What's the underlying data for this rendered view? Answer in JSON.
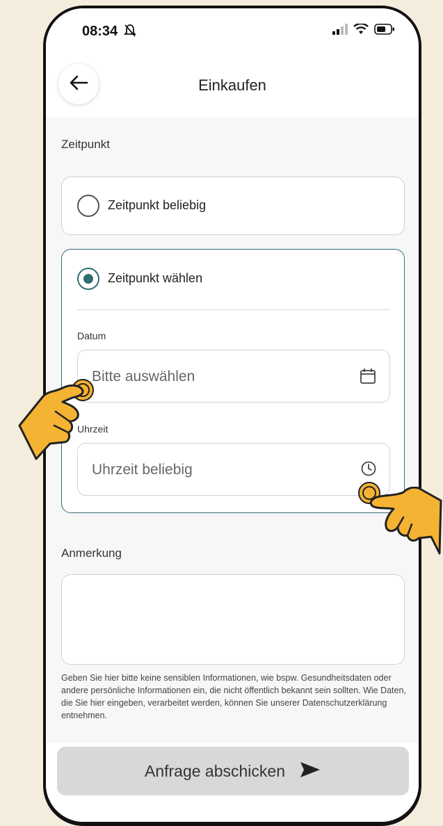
{
  "status_bar": {
    "time": "08:34",
    "icons": [
      "mute-icon",
      "signal-icon",
      "wifi-icon",
      "battery-icon"
    ]
  },
  "header": {
    "title": "Einkaufen",
    "back_icon": "arrow-left-icon"
  },
  "time_section": {
    "label": "Zeitpunkt",
    "options": [
      {
        "label": "Zeitpunkt beliebig",
        "selected": false
      },
      {
        "label": "Zeitpunkt wählen",
        "selected": true
      }
    ],
    "date": {
      "label": "Datum",
      "placeholder": "Bitte auswählen",
      "icon": "calendar-icon"
    },
    "time": {
      "label": "Uhrzeit",
      "placeholder": "Uhrzeit beliebig",
      "icon": "clock-icon"
    }
  },
  "note": {
    "label": "Anmerkung",
    "value": "",
    "hint": "Geben Sie hier bitte keine sensiblen Informationen, wie bspw. Gesundheitsdaten oder andere persönliche Informationen ein, die nicht öffentlich bekannt sein sollten. Wie Daten, die Sie hier eingeben, verarbeitet werden, können Sie unserer Datenschutzerklärung entnehmen."
  },
  "submit": {
    "label": "Anfrage abschicken",
    "icon": "send-icon"
  },
  "colors": {
    "accent": "#2f6e72",
    "background": "#f4ecdc",
    "hand": "#f5b333"
  }
}
